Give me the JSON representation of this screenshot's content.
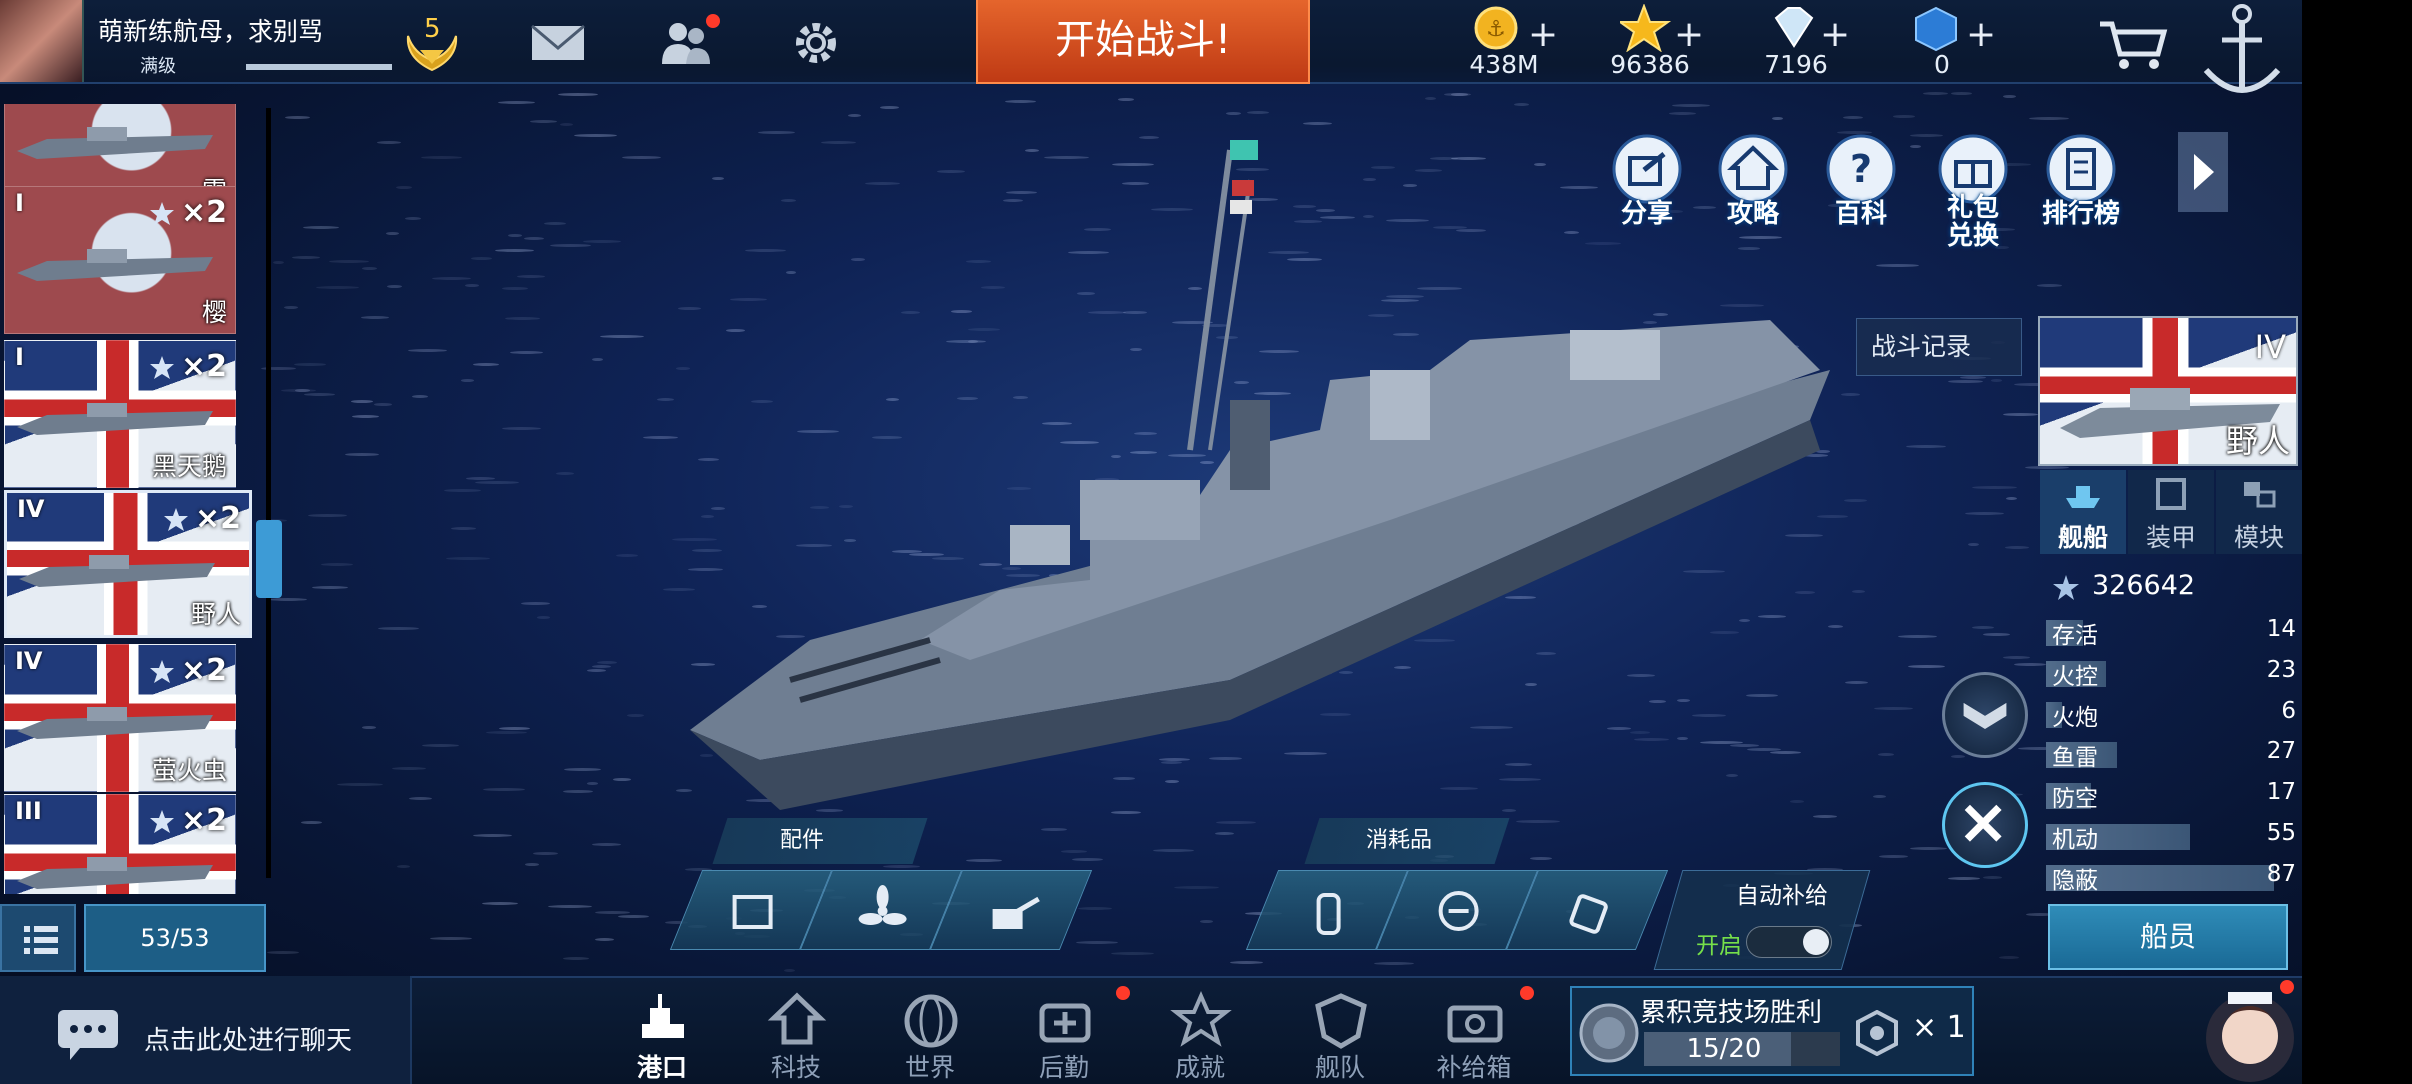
{
  "player": {
    "name": "萌新练航母，求别骂",
    "level_label": "满级",
    "exp_fraction": 1.0,
    "rank": "5"
  },
  "top_actions": {
    "start_battle": "开始战斗!"
  },
  "currencies": [
    {
      "icon": "gold-anchor-coin-icon",
      "value": "438M"
    },
    {
      "icon": "gold-star-icon",
      "value": "96386"
    },
    {
      "icon": "diamond-icon",
      "value": "7196"
    },
    {
      "icon": "blue-cube-icon",
      "value": "0"
    }
  ],
  "quick_menu": [
    {
      "icon": "share-icon",
      "label": "分享"
    },
    {
      "icon": "guide-home-icon",
      "label": "攻略"
    },
    {
      "icon": "wiki-question-icon",
      "label": "百科"
    },
    {
      "icon": "gift-exchange-icon",
      "label": "礼包\n兑换"
    },
    {
      "icon": "ranking-icon",
      "label": "排行榜"
    }
  ],
  "ship_list": {
    "items": [
      {
        "tier": "",
        "multiplier": "",
        "name": "雪",
        "flag": "red"
      },
      {
        "tier": "I",
        "multiplier": "×2",
        "name": "樱",
        "flag": "red"
      },
      {
        "tier": "I",
        "multiplier": "×2",
        "name": "黑天鹅",
        "flag": "uk"
      },
      {
        "tier": "IV",
        "multiplier": "×2",
        "name": "野人",
        "flag": "uk",
        "selected": true
      },
      {
        "tier": "IV",
        "multiplier": "×2",
        "name": "萤火虫",
        "flag": "uk"
      },
      {
        "tier": "III",
        "multiplier": "×2",
        "name": "",
        "flag": "uk"
      }
    ],
    "count": "53/53"
  },
  "ship_panel": {
    "battle_record": "战斗记录",
    "tier": "IV",
    "name": "野人",
    "tabs": [
      "舰船",
      "装甲",
      "模块"
    ],
    "power": "326642",
    "stats": [
      {
        "label": "存活",
        "value": "14"
      },
      {
        "label": "火控",
        "value": "23"
      },
      {
        "label": "火炮",
        "value": "6"
      },
      {
        "label": "鱼雷",
        "value": "27"
      },
      {
        "label": "防空",
        "value": "17"
      },
      {
        "label": "机动",
        "value": "55"
      },
      {
        "label": "隐蔽",
        "value": "87"
      }
    ],
    "crew_button": "船员"
  },
  "equipment": {
    "parts_label": "配件",
    "consumables_label": "消耗品",
    "auto_supply_label": "自动补给",
    "auto_supply_state": "开启"
  },
  "bottom": {
    "chat_prompt": "点击此处进行聊天",
    "nav": [
      {
        "icon": "port-icon",
        "label": "港口",
        "active": true
      },
      {
        "icon": "tech-icon",
        "label": "科技"
      },
      {
        "icon": "world-icon",
        "label": "世界"
      },
      {
        "icon": "logistics-icon",
        "label": "后勤"
      },
      {
        "icon": "achievement-icon",
        "label": "成就"
      },
      {
        "icon": "fleet-icon",
        "label": "舰队"
      },
      {
        "icon": "supply-box-icon",
        "label": "补给箱"
      }
    ],
    "arena": {
      "title": "累积竞技场胜利",
      "progress": "15/20",
      "reward": "× 1"
    }
  },
  "colors": {
    "start_battle": "#d54d20",
    "accent_blue": "#2f8cb8",
    "notification": "#ff3a2a",
    "gold": "#ffcf4a"
  }
}
